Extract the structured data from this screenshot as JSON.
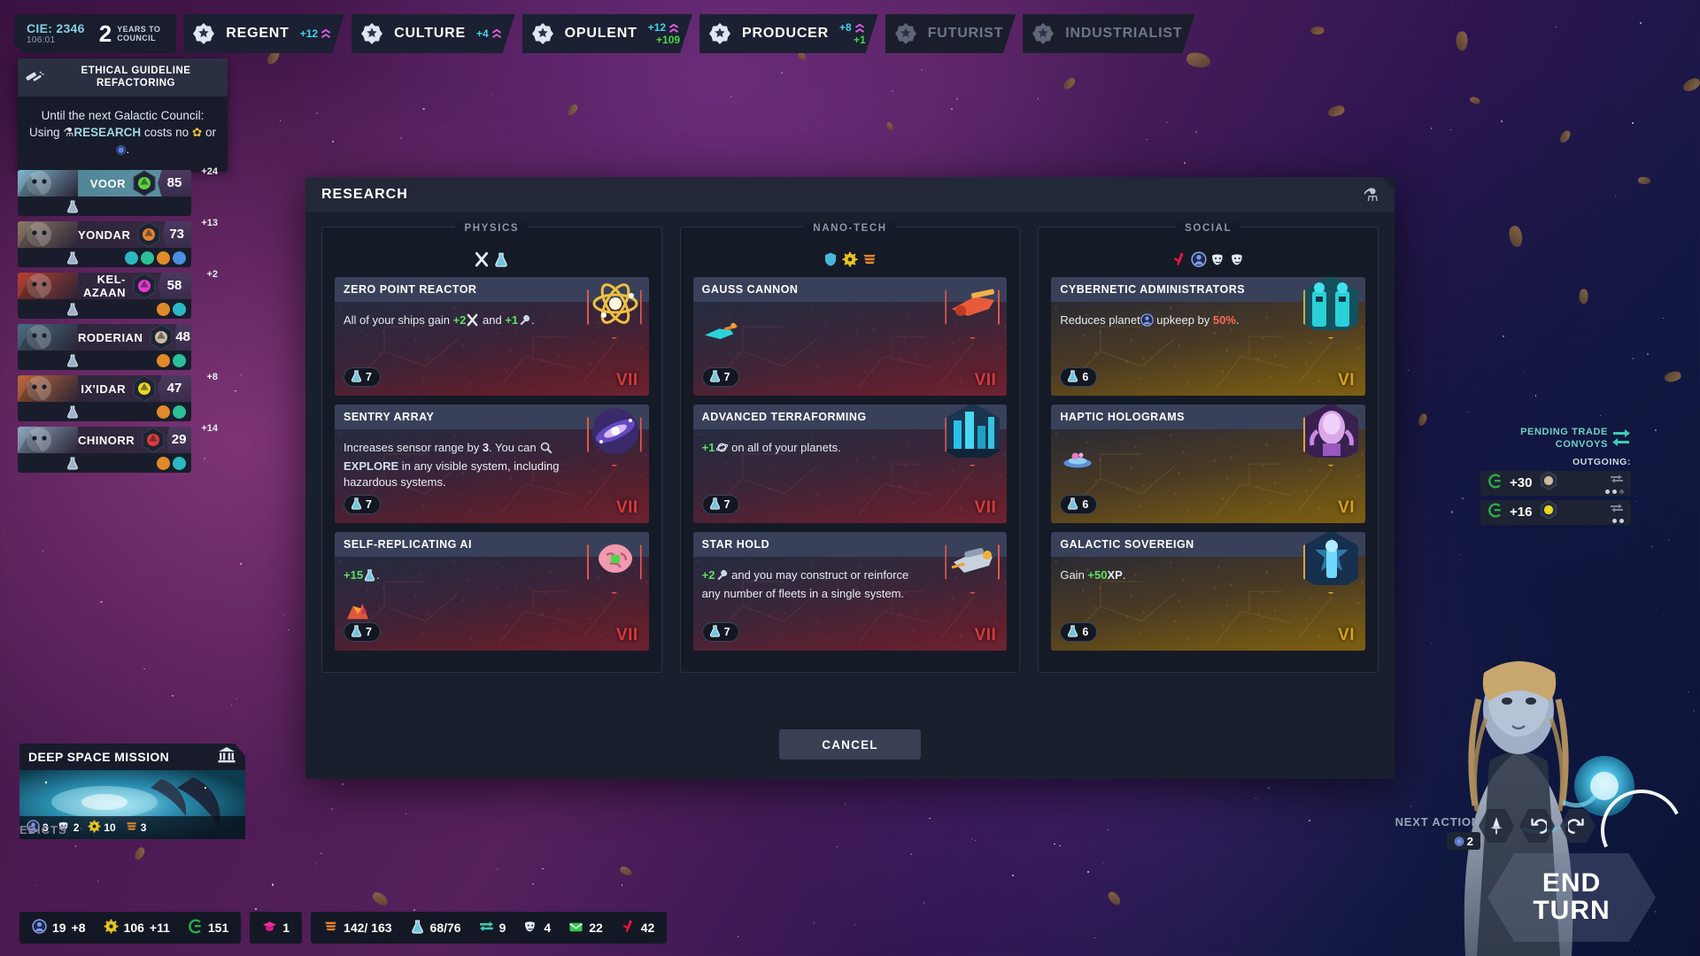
{
  "topbar": {
    "cie_label": "CIE: 2346",
    "cie_time": "106:01",
    "years_num": "2",
    "years_label_l1": "YEARS TO",
    "years_label_l2": "COUNCIL",
    "victories": [
      {
        "name": "REGENT",
        "v1": "+12",
        "v2": "",
        "active": true
      },
      {
        "name": "CULTURE",
        "v1": "+4",
        "v2": "",
        "active": true
      },
      {
        "name": "OPULENT",
        "v1": "+12",
        "v2": "+109",
        "active": true
      },
      {
        "name": "PRODUCER",
        "v1": "+8",
        "v2": "+1",
        "active": true
      },
      {
        "name": "FUTURIST",
        "v1": "",
        "v2": "",
        "active": false
      },
      {
        "name": "INDUSTRIALIST",
        "v1": "",
        "v2": "",
        "active": false
      }
    ]
  },
  "edict": {
    "icon": "gavel-icon",
    "title": "ETHICAL GUIDELINE REFACTORING",
    "body_pre": "Until the next Galactic Council: Using ",
    "body_hl": "RESEARCH",
    "body_mid": " costs no ",
    "body_post": " or ",
    "body_end": "."
  },
  "factions": [
    {
      "name": "VOOR",
      "score": "85",
      "delta": "+24",
      "active": true,
      "pips": [],
      "emblem": "#5dd43a",
      "portrait": "#7fb9cf"
    },
    {
      "name": "YONDAR",
      "score": "73",
      "delta": "+13",
      "active": false,
      "pips": [
        "#2bb8c4",
        "#2bbf9a",
        "#e08a2a",
        "#4a8fe0"
      ],
      "emblem": "#e0842a",
      "portrait": "#8c7a66"
    },
    {
      "name": "KEL-AZAAN",
      "score": "58",
      "delta": "+2",
      "active": false,
      "pips": [
        "#e08a2a",
        "#2bb8c4"
      ],
      "emblem": "#e838d0",
      "portrait": "#b8422e"
    },
    {
      "name": "RODERIAN",
      "score": "48",
      "delta": "",
      "active": false,
      "pips": [
        "#e08a2a",
        "#2bbf9a"
      ],
      "emblem": "#cdbba0",
      "portrait": "#4a6e82"
    },
    {
      "name": "IX'IDAR",
      "score": "47",
      "delta": "+8",
      "active": false,
      "pips": [
        "#e08a2a",
        "#2bbf9a"
      ],
      "emblem": "#e8d820",
      "portrait": "#c06a3a"
    },
    {
      "name": "CHINORR",
      "score": "29",
      "delta": "+14",
      "active": false,
      "pips": [
        "#e08a2a",
        "#2bb8c4"
      ],
      "emblem": "#e03a3a",
      "portrait": "#8ea8c0"
    }
  ],
  "research": {
    "title": "RESEARCH",
    "header_icon": "flask-icon",
    "cancel_label": "CANCEL",
    "columns": [
      {
        "name": "PHYSICS",
        "icons": [
          "attack-icon",
          "flask-icon"
        ],
        "techs": [
          {
            "title": "ZERO POINT REACTOR",
            "cost": "7",
            "tier": "VII",
            "tier_color": "red",
            "desc": [
              {
                "t": "All of your ships gain "
              },
              {
                "t": "+2",
                "c": "g"
              },
              {
                "i": "attack-icon"
              },
              {
                "t": " and "
              },
              {
                "t": "+1",
                "c": "g"
              },
              {
                "i": "wrench-icon"
              },
              {
                "t": "."
              }
            ],
            "art": "atom-icon"
          },
          {
            "title": "SENTRY ARRAY",
            "cost": "7",
            "tier": "VII",
            "tier_color": "red",
            "desc": [
              {
                "t": "Increases sensor range by "
              },
              {
                "t": "3",
                "c": "w"
              },
              {
                "t": ". You can "
              },
              {
                "i": "magnifier-icon"
              },
              {
                "t": "EXPLORE",
                "c": "b"
              },
              {
                "t": " in any visible system, including hazardous systems."
              }
            ],
            "art": "galaxy-icon"
          },
          {
            "title": "SELF-REPLICATING AI",
            "cost": "7",
            "tier": "VII",
            "tier_color": "red",
            "desc": [
              {
                "t": "+15",
                "c": "g"
              },
              {
                "i": "flask-icon"
              },
              {
                "t": "."
              }
            ],
            "art": "brain-icon",
            "sub_art": "crystal-icon"
          }
        ]
      },
      {
        "name": "NANO-TECH",
        "icons": [
          "shield-icon",
          "gear-icon",
          "production-icon"
        ],
        "techs": [
          {
            "title": "GAUSS CANNON",
            "cost": "7",
            "tier": "VII",
            "tier_color": "red",
            "desc": [],
            "art": "cannon-icon",
            "sub_art": "gauss-weapon-icon"
          },
          {
            "title": "ADVANCED TERRAFORMING",
            "cost": "7",
            "tier": "VII",
            "tier_color": "red",
            "desc": [
              {
                "t": "+1",
                "c": "g"
              },
              {
                "i": "planet-icon"
              },
              {
                "t": " on all of your planets."
              }
            ],
            "art": "terraform-icon"
          },
          {
            "title": "STAR HOLD",
            "cost": "7",
            "tier": "VII",
            "tier_color": "red",
            "desc": [
              {
                "t": "+2",
                "c": "g"
              },
              {
                "i": "wrench-icon"
              },
              {
                "t": " and you may construct or reinforce any number of fleets in a single system."
              }
            ],
            "art": "starhold-icon"
          }
        ]
      },
      {
        "name": "SOCIAL",
        "icons": [
          "dagger-icon",
          "person-icon",
          "mask-icon",
          "culture-icon"
        ],
        "techs": [
          {
            "title": "CYBERNETIC ADMINISTRATORS",
            "cost": "6",
            "tier": "VI",
            "tier_color": "gold",
            "desc": [
              {
                "t": "Reduces planet"
              },
              {
                "i": "person-icon"
              },
              {
                "t": " upkeep by "
              },
              {
                "t": "50%",
                "c": "r"
              },
              {
                "t": "."
              }
            ],
            "art": "cyber-admin-icon"
          },
          {
            "title": "HAPTIC HOLOGRAMS",
            "cost": "6",
            "tier": "VI",
            "tier_color": "gold",
            "desc": [],
            "art": "hologram-icon",
            "sub_art": "hologram-disc-icon"
          },
          {
            "title": "GALACTIC SOVEREIGN",
            "cost": "6",
            "tier": "VI",
            "tier_color": "gold",
            "desc": [
              {
                "t": "Gain "
              },
              {
                "t": "+50",
                "c": "g"
              },
              {
                "t": "XP",
                "c": "w"
              },
              {
                "t": "."
              }
            ],
            "art": "sovereign-icon"
          }
        ]
      }
    ]
  },
  "deep_space_mission": {
    "title": "DEEP SPACE MISSION",
    "icon": "temple-icon",
    "stats": [
      {
        "icon": "person-icon",
        "value": "3"
      },
      {
        "icon": "culture-icon",
        "value": "2"
      },
      {
        "icon": "gear-icon",
        "value": "10"
      },
      {
        "icon": "prod-icon",
        "value": "3"
      }
    ],
    "edicts_label": "EDICTS"
  },
  "bottom_bar": [
    {
      "items": [
        {
          "icon": "person-icon",
          "value": "19",
          "plus": "+8"
        },
        {
          "icon": "gear-icon",
          "value": "106",
          "plus": "+11"
        },
        {
          "icon": "credit-icon",
          "value": "151",
          "plus": ""
        }
      ]
    },
    {
      "items": [
        {
          "icon": "grad-cap-icon",
          "value": "1",
          "plus": ""
        }
      ]
    },
    {
      "items": [
        {
          "icon": "production-icon",
          "value": "142/ 163",
          "plus": ""
        },
        {
          "icon": "flask-icon",
          "value": "68/76",
          "plus": ""
        },
        {
          "icon": "trade-icon",
          "value": "9",
          "plus": ""
        },
        {
          "icon": "mask-icon",
          "value": "4",
          "plus": ""
        },
        {
          "icon": "envelope-icon",
          "value": "22",
          "plus": ""
        },
        {
          "icon": "dagger-icon",
          "value": "42",
          "plus": ""
        }
      ]
    }
  ],
  "convoys": {
    "title_l1": "PENDING TRADE",
    "title_l2": "CONVOYS",
    "outgoing_label": "OUTGOING:",
    "rows": [
      {
        "amount": "+30",
        "emblem": "#cdbba0",
        "dots": 3,
        "dots_on": 2
      },
      {
        "amount": "+16",
        "emblem": "#e8d820",
        "dots": 2,
        "dots_on": 2
      }
    ]
  },
  "next_action": {
    "label": "NEXT ACTION",
    "icon": "person-icon",
    "value": "2"
  },
  "action_buttons": [
    {
      "icon": "ship-icon"
    },
    {
      "icon": "undo-icon"
    },
    {
      "icon": "redo-icon"
    }
  ],
  "end_turn": {
    "line1": "END",
    "line2": "TURN"
  },
  "colors": {
    "green": "#5fe05f",
    "cyan": "#46d2e8",
    "red": "#ff6a5a",
    "gold": "#d6a21e",
    "tier_red": "#d63b3b"
  }
}
